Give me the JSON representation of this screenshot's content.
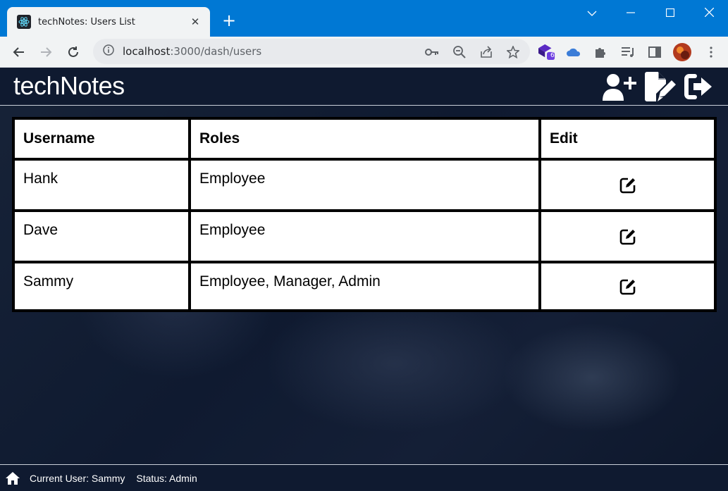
{
  "browser": {
    "tab_title": "techNotes: Users List",
    "tab_close": "✕",
    "new_tab": "+",
    "url_host": "localhost",
    "url_rest": ":3000/dash/users",
    "extension_badge": "6",
    "accent_color": "#0078d4"
  },
  "app": {
    "title": "techNotes",
    "header_buttons": [
      "add-user-icon",
      "new-note-icon",
      "logout-icon"
    ],
    "table": {
      "headers": [
        "Username",
        "Roles",
        "Edit"
      ],
      "rows": [
        {
          "username": "Hank",
          "roles": "Employee"
        },
        {
          "username": "Dave",
          "roles": "Employee"
        },
        {
          "username": "Sammy",
          "roles": "Employee, Manager, Admin"
        }
      ]
    },
    "footer": {
      "current_user": "Current User: Sammy",
      "status": "Status: Admin"
    },
    "colors": {
      "header_bg": "#0f1a30",
      "text": "#ffffff"
    }
  }
}
